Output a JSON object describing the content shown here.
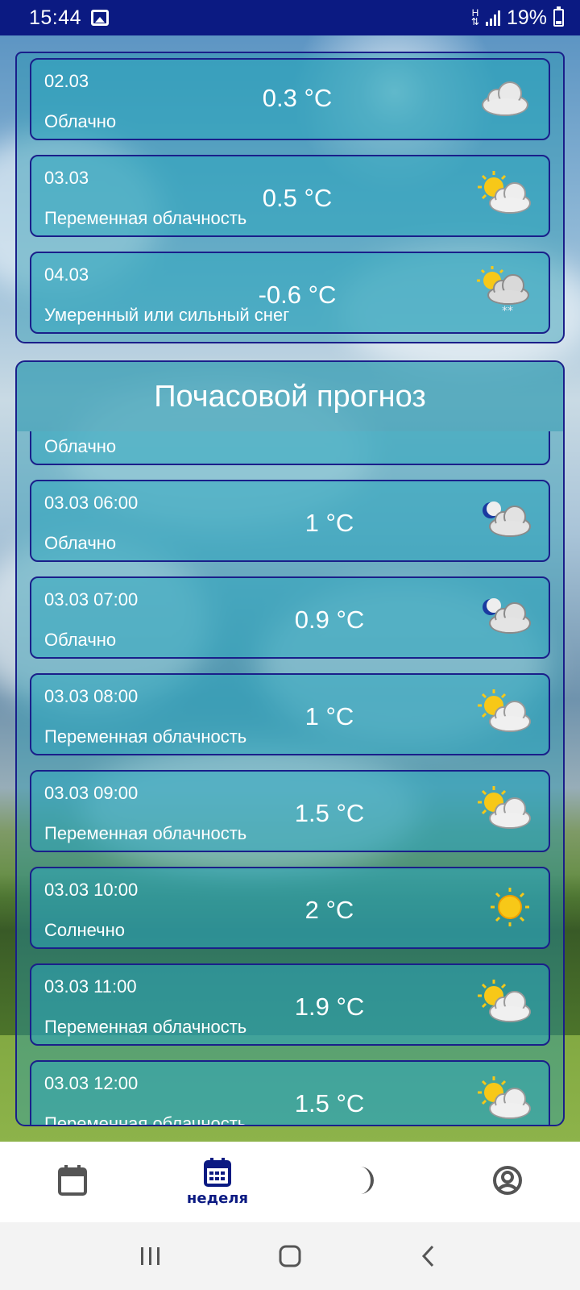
{
  "status_bar": {
    "time": "15:44",
    "network": "H",
    "battery": "19%"
  },
  "daily": [
    {
      "date": "02.03",
      "temp": "0.3 °C",
      "desc": "Облачно",
      "icon": "cloud-icon"
    },
    {
      "date": "03.03",
      "temp": "0.5 °C",
      "desc": "Переменная облачность",
      "icon": "partly-cloudy-icon"
    },
    {
      "date": "04.03",
      "temp": "-0.6 °C",
      "desc": "Умеренный или сильный снег",
      "icon": "snow-cloud-icon"
    }
  ],
  "hourly": {
    "title": "Почасовой прогноз",
    "items": [
      {
        "date": "",
        "temp": "",
        "desc": "Облачно",
        "icon": "cloud-icon"
      },
      {
        "date": "03.03 06:00",
        "temp": "1 °C",
        "desc": "Облачно",
        "icon": "night-cloud-icon"
      },
      {
        "date": "03.03 07:00",
        "temp": "0.9 °C",
        "desc": "Облачно",
        "icon": "night-cloud-icon"
      },
      {
        "date": "03.03 08:00",
        "temp": "1 °C",
        "desc": "Переменная облачность",
        "icon": "partly-cloudy-icon"
      },
      {
        "date": "03.03 09:00",
        "temp": "1.5 °C",
        "desc": "Переменная облачность",
        "icon": "partly-cloudy-icon"
      },
      {
        "date": "03.03 10:00",
        "temp": "2 °C",
        "desc": "Солнечно",
        "icon": "sun-icon"
      },
      {
        "date": "03.03 11:00",
        "temp": "1.9 °C",
        "desc": "Переменная облачность",
        "icon": "partly-cloudy-icon"
      },
      {
        "date": "03.03 12:00",
        "temp": "1.5 °C",
        "desc": "Переменная облачность",
        "icon": "partly-cloudy-icon"
      }
    ]
  },
  "bottom_nav": {
    "items": [
      {
        "label": "",
        "icon": "calendar-icon"
      },
      {
        "label": "неделя",
        "icon": "calendar-week-icon",
        "active": true
      },
      {
        "label": "",
        "icon": "moon-icon"
      },
      {
        "label": "",
        "icon": "account-icon"
      }
    ]
  },
  "colors": {
    "accent": "#0b1a82",
    "card_border": "#1a1f8a",
    "card_fill": "#2da5be"
  }
}
